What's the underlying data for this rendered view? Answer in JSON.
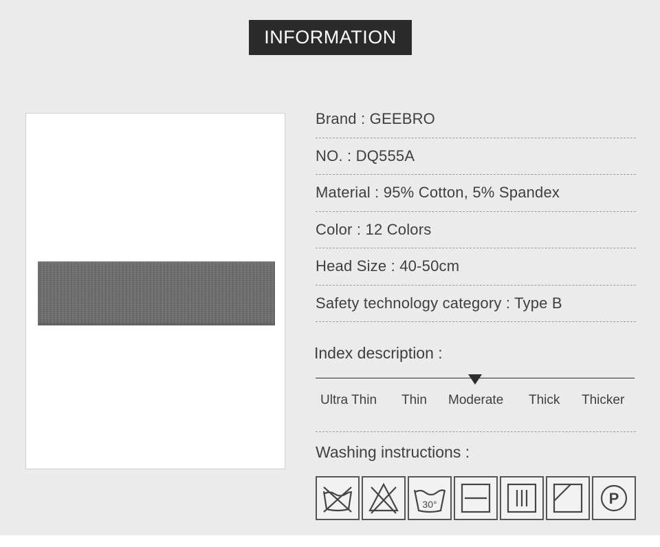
{
  "header": {
    "title": "INFORMATION"
  },
  "product_image": {
    "icon": "headband-photo",
    "color": "#6d6d6d"
  },
  "info": [
    {
      "label": "Brand",
      "value": "GEEBRO",
      "text": "Brand : GEEBRO"
    },
    {
      "label": "NO.",
      "value": "DQ555A",
      "text": "NO. : DQ555A"
    },
    {
      "label": "Material",
      "value": "95% Cotton, 5% Spandex",
      "text": "Material : 95% Cotton, 5% Spandex"
    },
    {
      "label": "Color",
      "value": "12 Colors",
      "text": "Color : 12 Colors"
    },
    {
      "label": "Head Size",
      "value": "40-50cm",
      "text": "Head Size : 40-50cm"
    },
    {
      "label": "Safety technology category",
      "value": "Type B",
      "text": "Safety technology category : Type B"
    }
  ],
  "index": {
    "title": "Index description :",
    "levels": [
      "Ultra Thin",
      "Thin",
      "Moderate",
      "Thick",
      "Thicker"
    ],
    "selected": "Moderate"
  },
  "washing": {
    "title": "Washing instructions :",
    "icons": [
      {
        "name": "do-not-wash-icon"
      },
      {
        "name": "do-not-bleach-icon"
      },
      {
        "name": "wash-30-icon",
        "text": "30°"
      },
      {
        "name": "dry-flat-icon"
      },
      {
        "name": "drip-dry-icon"
      },
      {
        "name": "dry-in-shade-icon"
      },
      {
        "name": "professional-dry-clean-icon",
        "text": "P"
      }
    ]
  }
}
